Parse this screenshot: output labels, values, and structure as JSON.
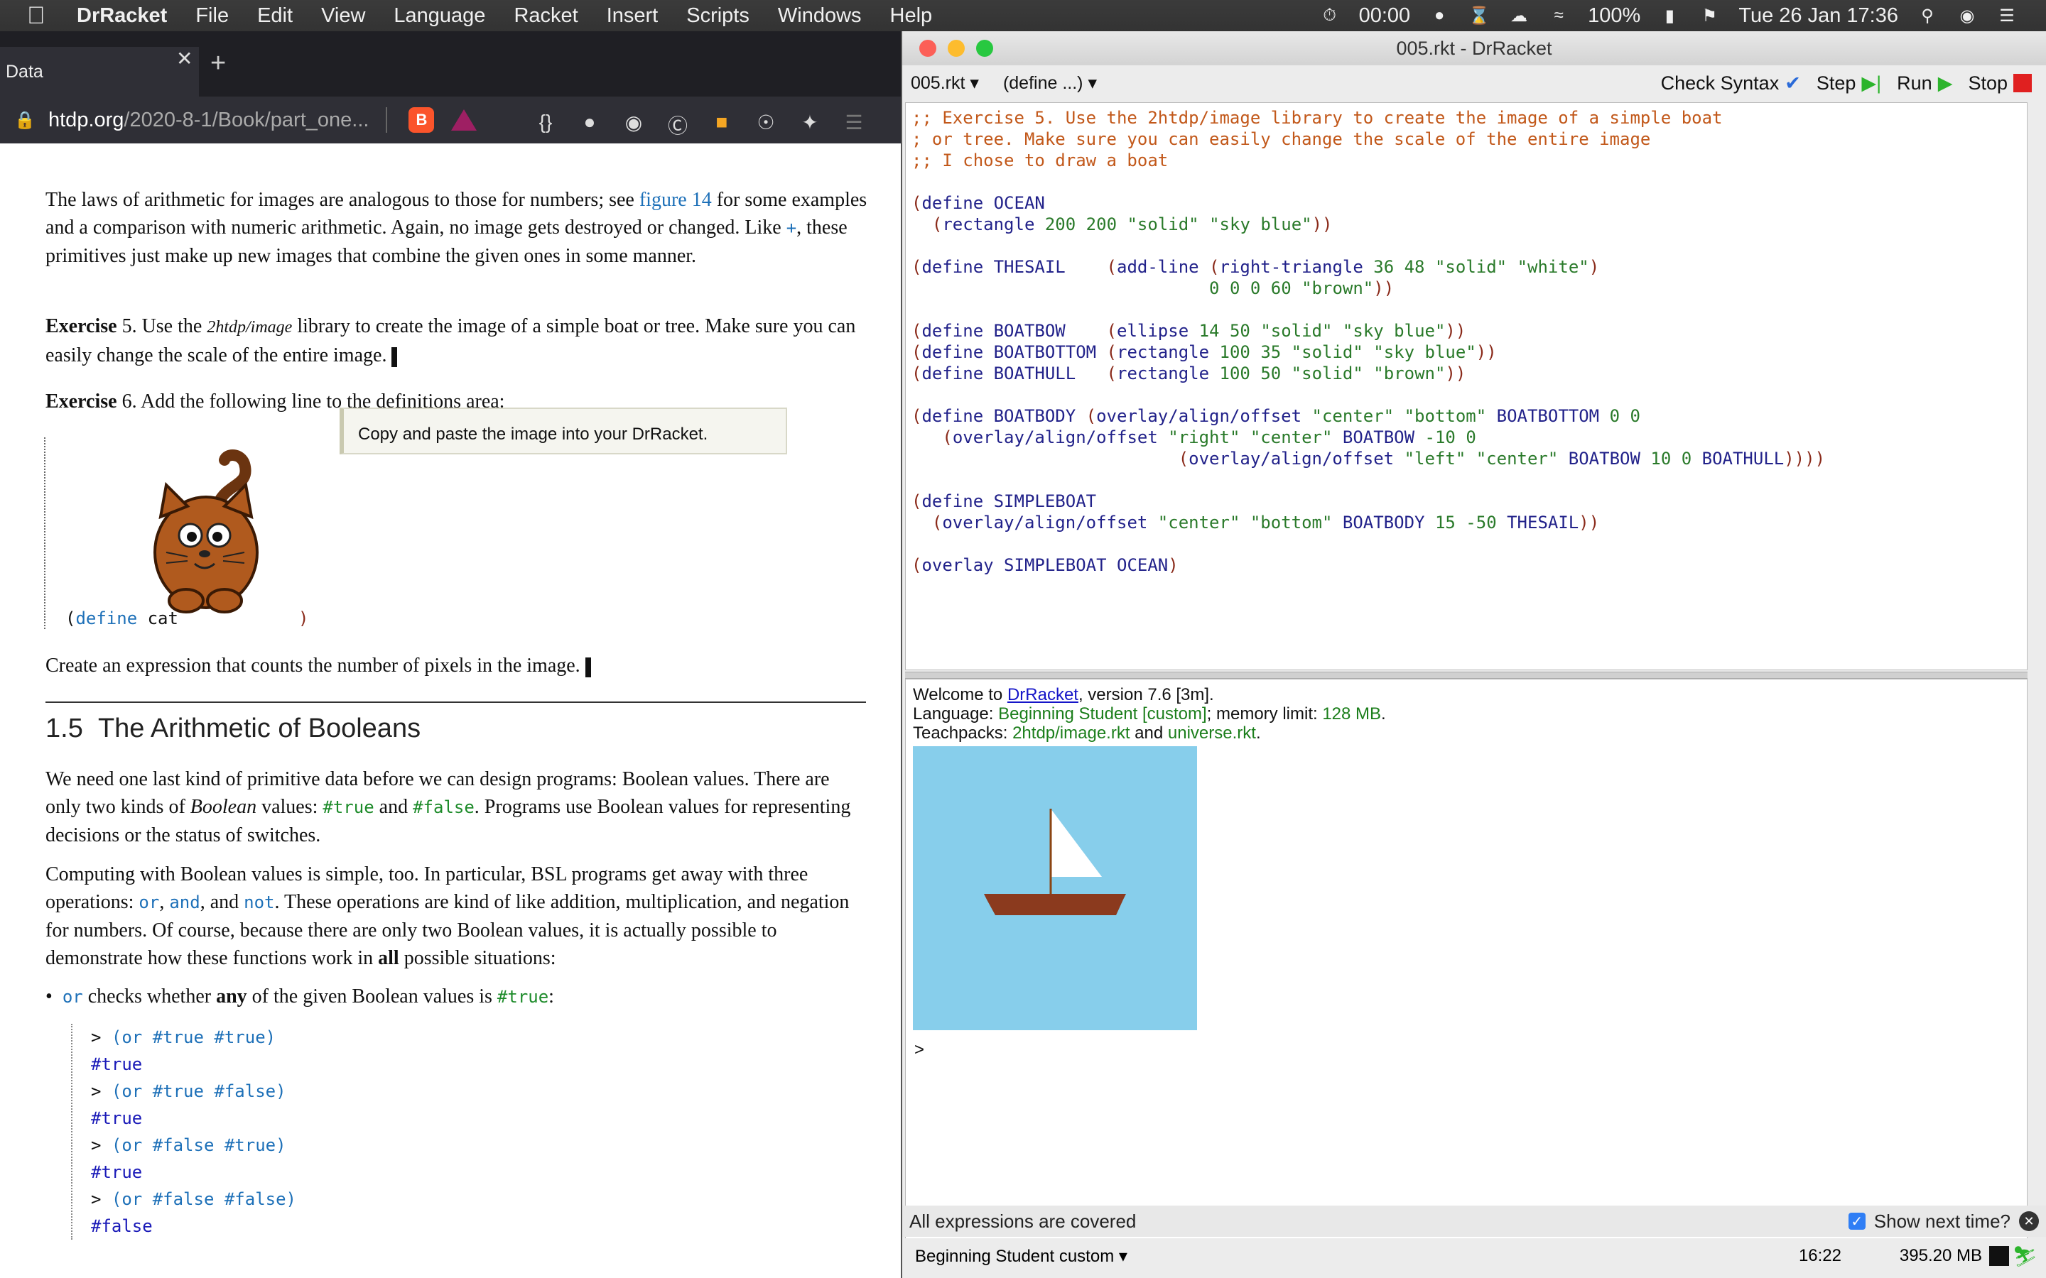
{
  "menubar": {
    "app_name": "DrRacket",
    "items": [
      "File",
      "Edit",
      "View",
      "Language",
      "Racket",
      "Insert",
      "Scripts",
      "Windows",
      "Help"
    ],
    "timer": "00:00",
    "battery": "100%",
    "clock": "Tue 26 Jan  17:36"
  },
  "browser": {
    "tab_title": "Data",
    "url_host": "htdp.org",
    "url_path": "/2020-8-1/Book/part_one...",
    "page": {
      "para1_a": "The laws of arithmetic for images are analogous to those for numbers; see ",
      "para1_link": "figure 14",
      "para1_b": " for some examples and a comparison with numeric arithmetic. Again, no image gets destroyed or changed. Like ",
      "para1_plus": "+",
      "para1_c": ", these primitives just make up new images that combine the given ones in some manner.",
      "ex5_label": "Exercise",
      "ex5_num": " 5. Use the ",
      "ex5_lib": "2htdp/image",
      "ex5_text": " library to create the image of a simple boat or tree. Make sure you can easily change the scale of the entire image.",
      "ex6_label": "Exercise",
      "ex6_text": " 6. Add the following line to the definitions area:",
      "note": "Copy and paste the image into your DrRacket.",
      "define_kw": "define",
      "define_name": "cat",
      "count_text": "Create an expression that counts the number of pixels in the image.",
      "section_number": "1.5",
      "section_title": "The Arithmetic of Booleans",
      "bool_p1_a": "We need one last kind of primitive data before we can design programs: Boolean values. There are only two kinds of ",
      "bool_p1_em": "Boolean",
      "bool_p1_b": " values: ",
      "true_val": "#true",
      "bool_p1_and": " and ",
      "false_val": "#false",
      "bool_p1_c": ". Programs use Boolean values for representing decisions or the status of switches.",
      "bool_p2_a": "Computing with Boolean values is simple, too. In particular, BSL programs get away with three operations: ",
      "op_or": "or",
      "op_and": "and",
      "op_not": "not",
      "bool_p2_b": ". These operations are kind of like addition, multiplication, and negation for numbers. Of course, because there are only two Boolean values, it is actually possible to demonstrate how these functions work in ",
      "bool_p2_all": "all",
      "bool_p2_c": " possible situations:",
      "bullet_a": " checks whether ",
      "bullet_any": "any",
      "bullet_b": " of the given Boolean values is ",
      "repl": [
        {
          "in": "(or #true #true)",
          "out": "#true"
        },
        {
          "in": "(or #true #false)",
          "out": "#true"
        },
        {
          "in": "(or #false #true)",
          "out": "#true"
        },
        {
          "in": "(or #false #false)",
          "out": "#false"
        }
      ]
    }
  },
  "drracket": {
    "window_title": "005.rkt - DrRacket",
    "file_menu": "005.rkt",
    "define_menu": "(define ...)",
    "buttons": {
      "check_syntax": "Check Syntax",
      "step": "Step",
      "run": "Run",
      "stop": "Stop"
    },
    "interactions": {
      "welcome_a": "Welcome to ",
      "welcome_link": "DrRacket",
      "welcome_b": ", version 7.6 [3m].",
      "lang_a": "Language: ",
      "lang_val": "Beginning Student [custom]",
      "lang_b": "; memory limit: ",
      "mem": "128 MB",
      "teach_a": "Teachpacks: ",
      "tp1": "2htdp/image.rkt",
      "teach_and": " and ",
      "tp2": "universe.rkt",
      "prompt": ">"
    },
    "status": {
      "message": "All expressions are covered",
      "show_next": "Show next time?",
      "language": "Beginning Student custom",
      "position": "16:22",
      "memory": "395.20 MB"
    }
  }
}
